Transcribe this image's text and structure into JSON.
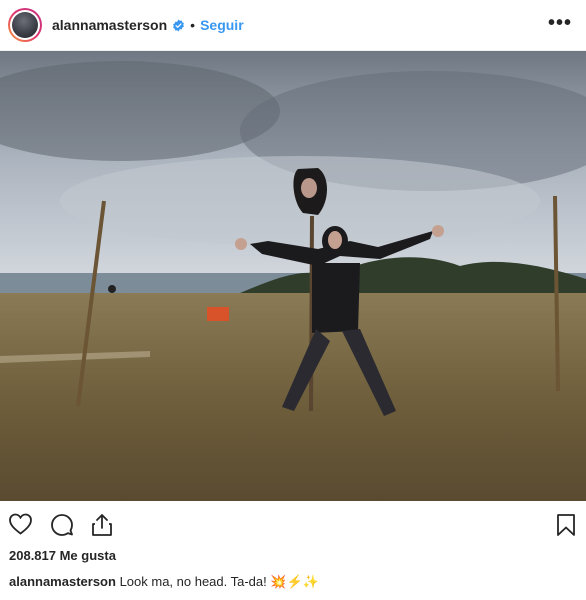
{
  "header": {
    "username": "alannamasterson",
    "separator": "•",
    "follow_label": "Seguir",
    "more_label": "•••"
  },
  "post": {
    "likes_text": "208.817 Me gusta",
    "caption_user": "alannamasterson",
    "caption_text": "Look ma, no head. Ta-da!",
    "caption_emoji": "💥⚡✨"
  },
  "icons": {
    "like": "heart-icon",
    "comment": "comment-icon",
    "share": "share-icon",
    "save": "bookmark-icon",
    "verified": "verified-badge-icon"
  },
  "colors": {
    "accent": "#3897f0",
    "text": "#262626"
  }
}
